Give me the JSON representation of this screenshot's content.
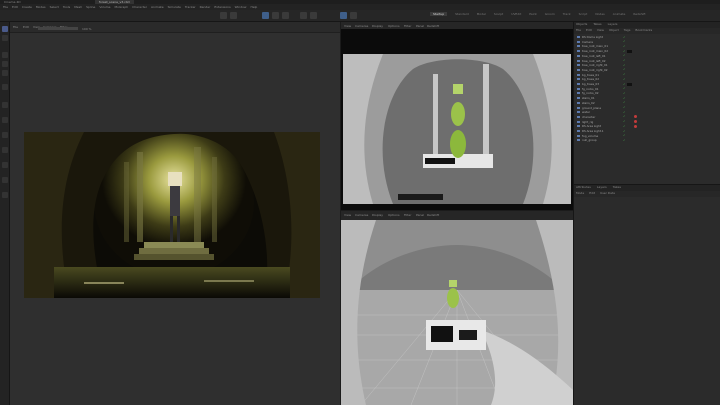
{
  "app": {
    "title": "Cinema 4D",
    "file_tab": "forest_scene_v3.c4d"
  },
  "menubar": [
    "File",
    "Edit",
    "Create",
    "Modes",
    "Select",
    "Tools",
    "Mesh",
    "Spline",
    "Volume",
    "MoGraph",
    "Character",
    "Animate",
    "Simulate",
    "Tracker",
    "Render",
    "Extensions",
    "Window",
    "Help"
  ],
  "layout_tabs": [
    {
      "label": "Startup",
      "active": true
    },
    {
      "label": "Standard"
    },
    {
      "label": "Model"
    },
    {
      "label": "Sculpt"
    },
    {
      "label": "UVEdit"
    },
    {
      "label": "Paint"
    },
    {
      "label": "Groom"
    },
    {
      "label": "Track"
    },
    {
      "label": "Script"
    },
    {
      "label": "Nodes"
    },
    {
      "label": "Animate"
    },
    {
      "label": "Redshift"
    }
  ],
  "render_panel": {
    "menu": [
      "File",
      "Edit",
      "View",
      "Compare",
      "Filter"
    ],
    "zoom": "100 %"
  },
  "viewport_top": {
    "menu": [
      "View",
      "Cameras",
      "Display",
      "Options",
      "Filter",
      "Panel",
      "Redshift"
    ]
  },
  "viewport_bottom": {
    "menu": [
      "View",
      "Cameras",
      "Display",
      "Options",
      "Filter",
      "Panel",
      "Redshift"
    ]
  },
  "objects_panel": {
    "tabs": [
      "Objects",
      "Takes",
      "Layers"
    ],
    "menu": [
      "File",
      "Edit",
      "View",
      "Object",
      "Tags",
      "Bookmarks"
    ],
    "items": [
      {
        "name": "RS Dome Light"
      },
      {
        "name": "Camera"
      },
      {
        "name": "tree_root_main_01"
      },
      {
        "name": "tree_root_main_02"
      },
      {
        "name": "tree_root_left_01"
      },
      {
        "name": "tree_root_left_02"
      },
      {
        "name": "tree_root_right_01"
      },
      {
        "name": "tree_root_right_02"
      },
      {
        "name": "bg_trees_01"
      },
      {
        "name": "bg_trees_02"
      },
      {
        "name": "bg_trees_03"
      },
      {
        "name": "fg_rocks_01"
      },
      {
        "name": "fg_rocks_02"
      },
      {
        "name": "stairs_01"
      },
      {
        "name": "stairs_02"
      },
      {
        "name": "ground_plane"
      },
      {
        "name": "water"
      },
      {
        "name": "character"
      },
      {
        "name": "light_rig"
      },
      {
        "name": "RS Area Light"
      },
      {
        "name": "RS Area Light.1"
      },
      {
        "name": "fog_volume"
      },
      {
        "name": "null_group"
      }
    ]
  },
  "attributes_panel": {
    "tabs": [
      "Attributes",
      "Layers",
      "Takes"
    ],
    "menu": [
      "Mode",
      "Edit",
      "User Data"
    ]
  }
}
